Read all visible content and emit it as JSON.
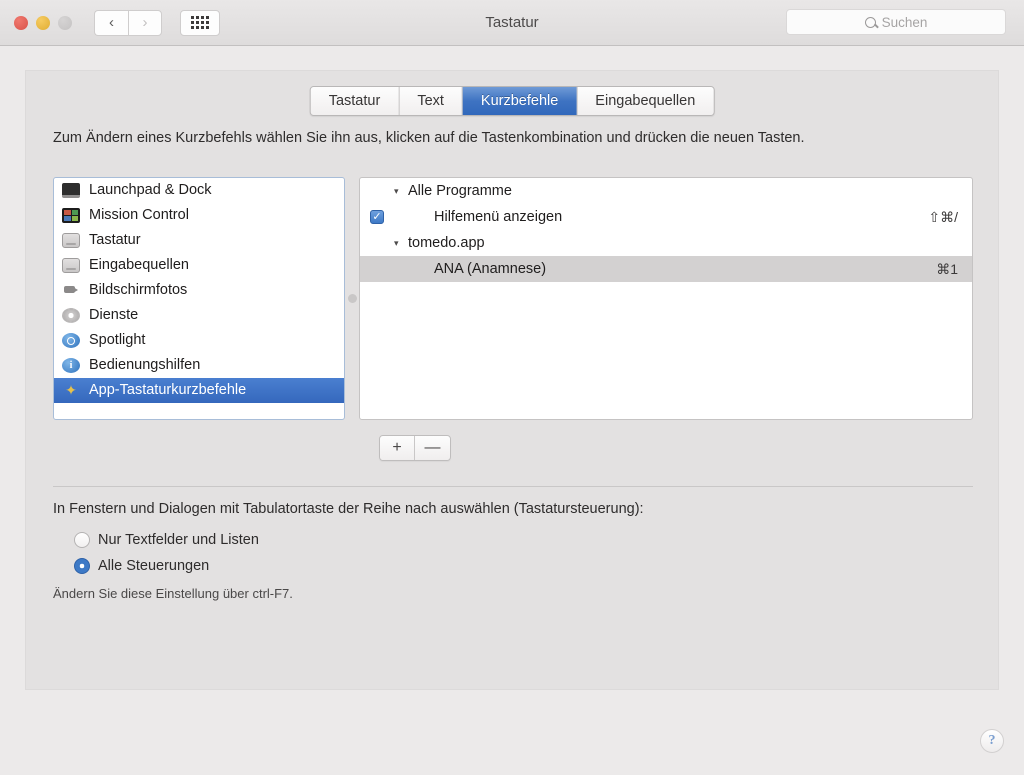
{
  "window": {
    "title": "Tastatur",
    "traffic_lights": [
      "close",
      "minimize",
      "zoom"
    ],
    "nav_back": "‹",
    "nav_forward": "›",
    "grid_button": "show-all-icon"
  },
  "search": {
    "placeholder": "Suchen",
    "icon": "search-icon"
  },
  "tabs": [
    {
      "label": "Tastatur",
      "active": false
    },
    {
      "label": "Text",
      "active": false
    },
    {
      "label": "Kurzbefehle",
      "active": true
    },
    {
      "label": "Eingabequellen",
      "active": false
    }
  ],
  "instruction": "Zum Ändern eines Kurzbefehls wählen Sie ihn aus, klicken auf die Tastenkombination und drücken die neuen Tasten.",
  "sidebar": {
    "items": [
      {
        "label": "Launchpad & Dock",
        "icon": "launchpad-dock-icon",
        "selected": false
      },
      {
        "label": "Mission Control",
        "icon": "mission-control-icon",
        "selected": false
      },
      {
        "label": "Tastatur",
        "icon": "keyboard-icon",
        "selected": false
      },
      {
        "label": "Eingabequellen",
        "icon": "input-sources-icon",
        "selected": false
      },
      {
        "label": "Bildschirmfotos",
        "icon": "screenshot-camera-icon",
        "selected": false
      },
      {
        "label": "Dienste",
        "icon": "services-gear-icon",
        "selected": false
      },
      {
        "label": "Spotlight",
        "icon": "spotlight-magnifier-icon",
        "selected": false
      },
      {
        "label": "Bedienungshilfen",
        "icon": "accessibility-info-icon",
        "selected": false
      },
      {
        "label": "App-Tastaturkurzbefehle",
        "icon": "app-shortcuts-star-icon",
        "selected": true
      }
    ]
  },
  "shortcuts": {
    "rows": [
      {
        "type": "group",
        "disclosure": "▾",
        "name": "Alle Programme",
        "key": "",
        "checkbox": null,
        "selected": false
      },
      {
        "type": "item",
        "disclosure": "",
        "name": "Hilfemenü anzeigen",
        "key": "⇧⌘/",
        "checkbox": true,
        "selected": false
      },
      {
        "type": "group",
        "disclosure": "▾",
        "name": "tomedo.app",
        "key": "",
        "checkbox": null,
        "selected": false
      },
      {
        "type": "item",
        "disclosure": "",
        "name": "ANA (Anamnese)",
        "key": "⌘1",
        "checkbox": null,
        "selected": true
      }
    ]
  },
  "list_buttons": {
    "add_label": "+",
    "remove_label": "—"
  },
  "keyboard_nav": {
    "heading": "In Fenstern und Dialogen mit Tabulatortaste der Reihe nach auswählen (Tastatursteuerung):",
    "options": [
      {
        "label": "Nur Textfelder und Listen",
        "selected": false
      },
      {
        "label": "Alle Steuerungen",
        "selected": true
      }
    ],
    "hint": "Ändern Sie diese Einstellung über ctrl-F7."
  },
  "help": {
    "label": "?"
  },
  "colors": {
    "accent_blue": "#3568bd",
    "tab_active_blue": "#3e73c2",
    "selection_gray": "#d3d1d1",
    "window_bg": "#eceaea",
    "panel_bg": "#e3e1e1"
  }
}
